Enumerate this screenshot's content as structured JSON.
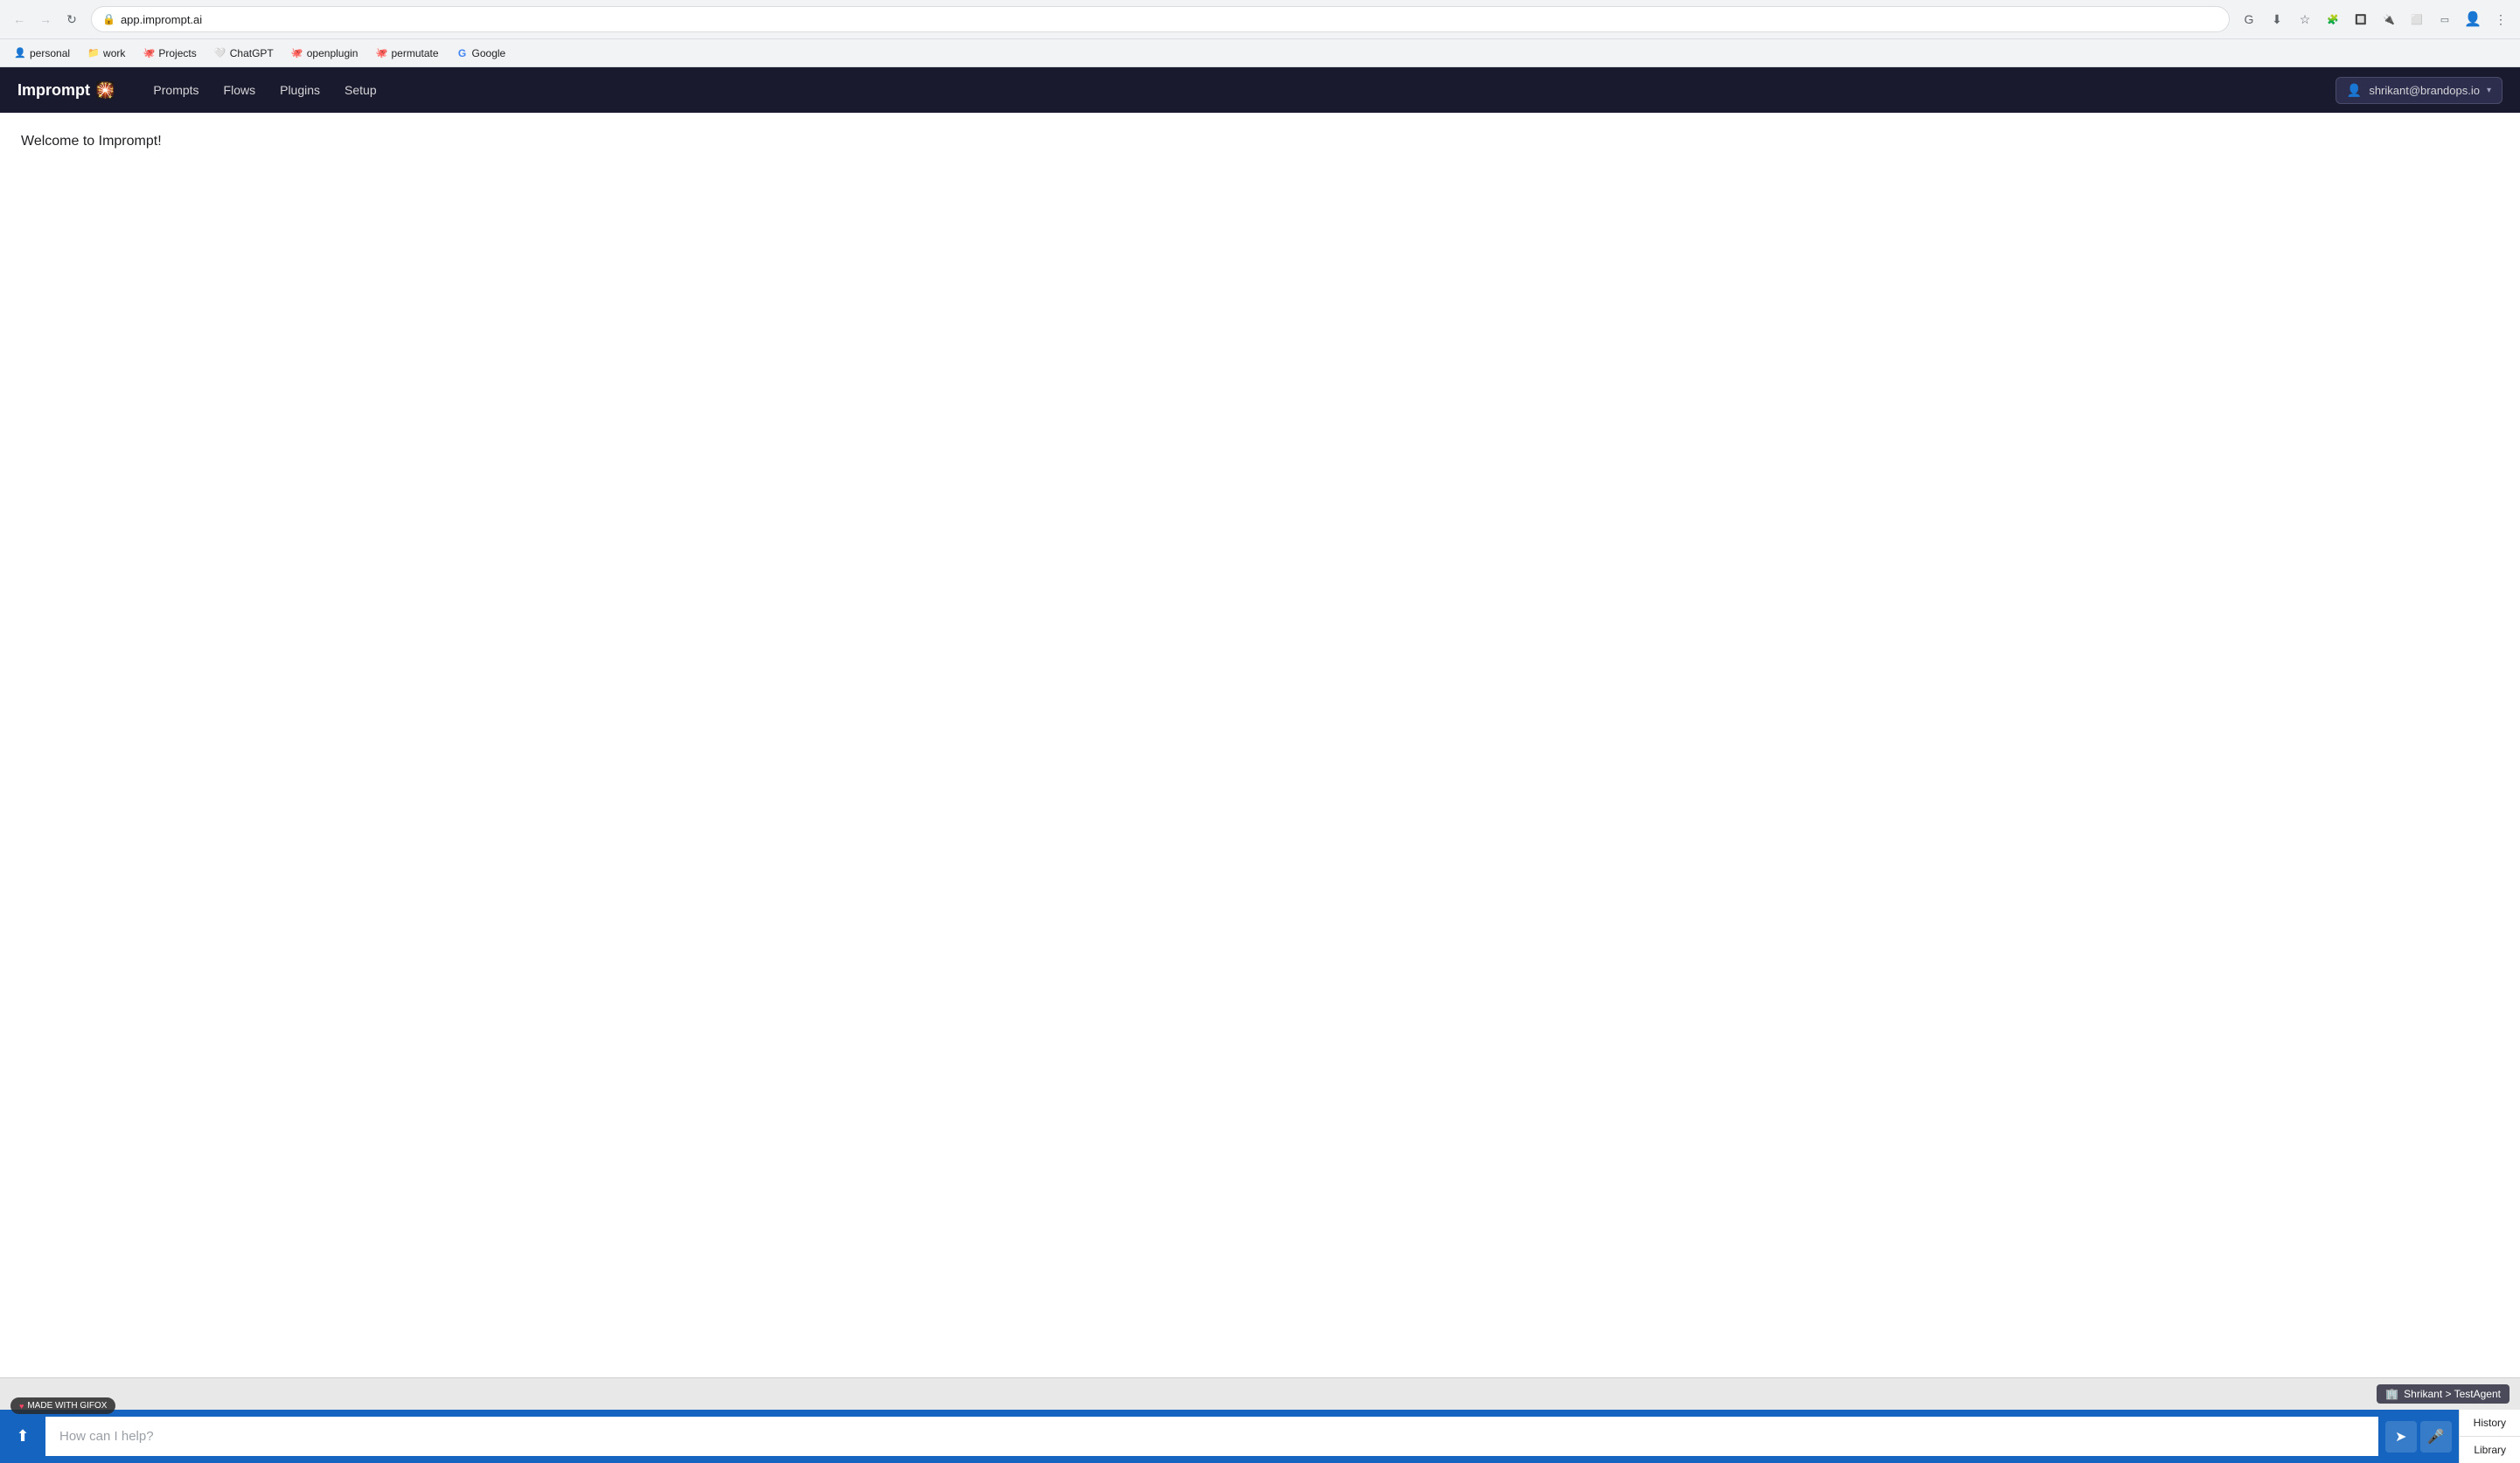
{
  "browser": {
    "url": "app.imprompt.ai",
    "nav_buttons": {
      "back_disabled": true,
      "forward_disabled": true
    },
    "bookmarks": [
      {
        "id": "personal",
        "label": "personal",
        "icon": "👤"
      },
      {
        "id": "work",
        "label": "work",
        "icon": "📁"
      },
      {
        "id": "projects",
        "label": "Projects",
        "icon": "🐙"
      },
      {
        "id": "chatgpt",
        "label": "ChatGPT",
        "icon": "🤍"
      },
      {
        "id": "openplugin",
        "label": "openplugin",
        "icon": "🐙"
      },
      {
        "id": "permutate",
        "label": "permutate",
        "icon": "🐙"
      },
      {
        "id": "google",
        "label": "Google",
        "icon": "G"
      }
    ]
  },
  "app": {
    "logo_text": "Imprompt",
    "logo_emoji": "🎇",
    "nav_links": [
      "Prompts",
      "Flows",
      "Plugins",
      "Setup"
    ],
    "user": {
      "email": "shrikant@brandops.io",
      "caret": "▾"
    }
  },
  "main": {
    "welcome_message": "Welcome to Imprompt!"
  },
  "chat": {
    "agent_label": "Shrikant > TestAgent",
    "input_placeholder": "How can I help?",
    "upload_icon": "⬆",
    "send_icon": "➤",
    "mic_icon": "🎤",
    "history_label": "History",
    "library_label": "Library"
  },
  "gifox": {
    "label": "MADE WITH GIFOX"
  }
}
